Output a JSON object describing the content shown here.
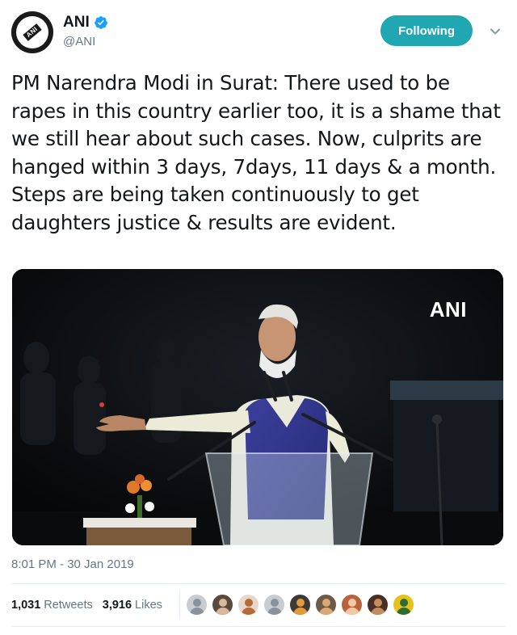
{
  "author": {
    "display_name": "ANI",
    "handle": "@ANI",
    "avatar_label": "ANI",
    "verified_icon": "verified-badge-icon"
  },
  "follow_button": {
    "label": "Following"
  },
  "menu": {
    "icon": "chevron-down-icon"
  },
  "tweet": {
    "text": "PM Narendra Modi in Surat: There used to be rapes in this country earlier too, it is a shame that we still hear about such cases. Now, culprits are hanged within 3 days, 7days, 11 days & a month. Steps are being taken continuously to get daughters justice & results are evident.",
    "media_watermark": "ANI",
    "timestamp": "8:01 PM - 30 Jan 2019"
  },
  "stats": {
    "retweets_count": "1,031",
    "retweets_label": "Retweets",
    "likes_count": "3,916",
    "likes_label": "Likes"
  },
  "liker_avatars": [
    {
      "name": "liker-avatar-1",
      "bg": "#c8ccd1",
      "fg": "#8a929b"
    },
    {
      "name": "liker-avatar-2",
      "bg": "#5a4a3e",
      "fg": "#d9b79a"
    },
    {
      "name": "liker-avatar-3",
      "bg": "#e9d8c9",
      "fg": "#b76a3a"
    },
    {
      "name": "liker-avatar-4",
      "bg": "#c8ccd1",
      "fg": "#8a929b"
    },
    {
      "name": "liker-avatar-5",
      "bg": "#3d3a36",
      "fg": "#e39a3d"
    },
    {
      "name": "liker-avatar-6",
      "bg": "#6d5a48",
      "fg": "#d9a873"
    },
    {
      "name": "liker-avatar-7",
      "bg": "#b8633e",
      "fg": "#f3c9a1"
    },
    {
      "name": "liker-avatar-8",
      "bg": "#4a2f24",
      "fg": "#c68d5c"
    },
    {
      "name": "liker-avatar-9",
      "bg": "#e8c21c",
      "fg": "#2f6b2f"
    }
  ],
  "colors": {
    "accent": "#20a7b2",
    "verified": "#1da1f2",
    "secondary_text": "#657786"
  }
}
